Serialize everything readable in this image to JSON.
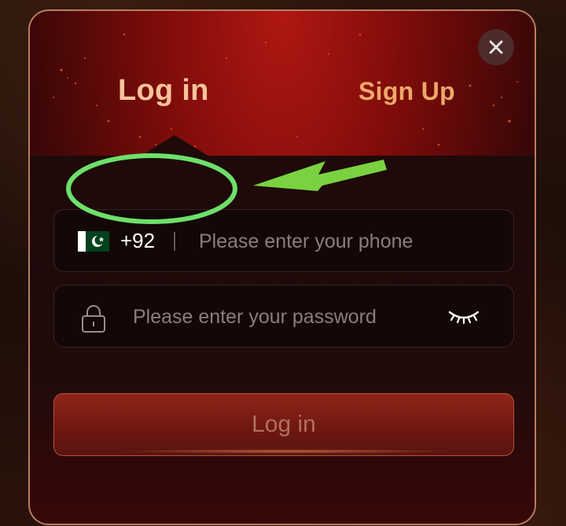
{
  "tabs": {
    "login_label": "Log in",
    "signup_label": "Sign Up"
  },
  "phone": {
    "country_code": "+92",
    "flag": "pakistan-flag",
    "placeholder": "Please enter your phone"
  },
  "password": {
    "placeholder": "Please enter your password",
    "icon": "lock-icon",
    "toggle_icon": "eye-closed-icon"
  },
  "submit": {
    "label": "Log in"
  },
  "colors": {
    "accent": "#f1b47f",
    "panel": "#1d0a09",
    "annotation": "#6de06a"
  }
}
